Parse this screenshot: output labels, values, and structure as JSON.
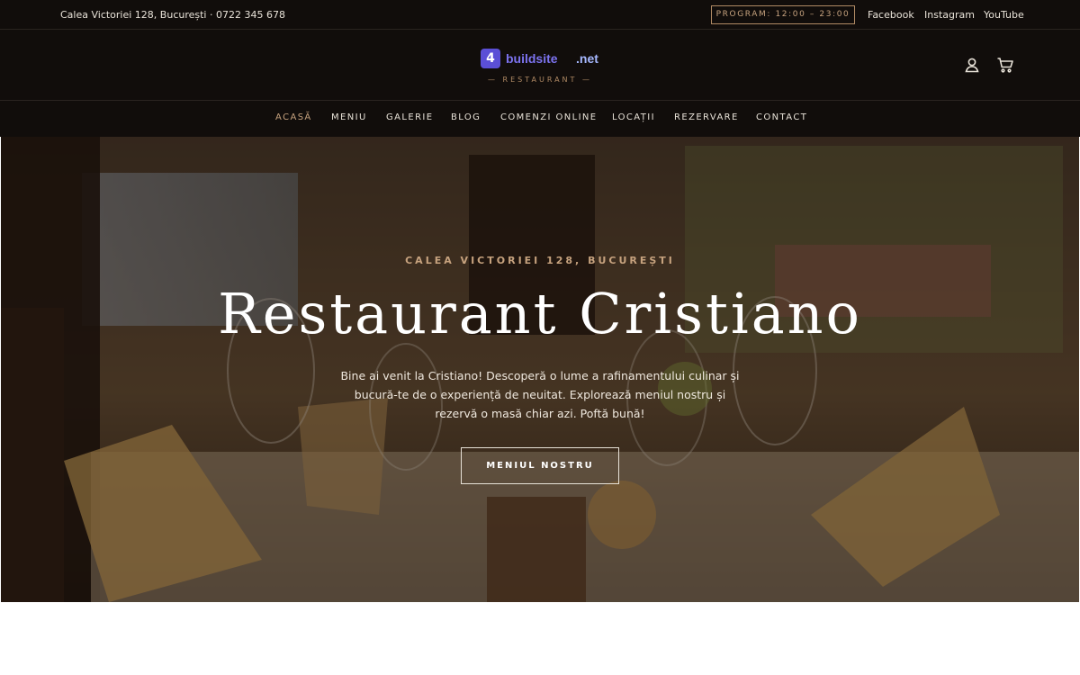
{
  "topbar": {
    "address_phone": "Calea Victoriei 128, București · 0722 345 678",
    "hours": "PROGRAM: 12:00 – 23:00",
    "social": [
      "Facebook",
      "Instagram",
      "YouTube"
    ]
  },
  "header": {
    "logo": {
      "badge": "4",
      "name": "buildsite",
      "tld": ".net",
      "tagline": "— RESTAURANT —"
    },
    "icons": [
      "user-icon",
      "cart-icon"
    ]
  },
  "nav": {
    "items": [
      "ACASĂ",
      "MENIU",
      "GALERIE",
      "BLOG",
      "COMENZI ONLINE",
      "LOCAȚII",
      "REZERVARE",
      "CONTACT"
    ],
    "active": "ACASĂ"
  },
  "hero": {
    "eyebrow": "CALEA VICTORIEI 128, BUCUREȘTI",
    "title": "Restaurant Cristiano",
    "lead": "Bine ai venit la Cristiano! Descoperă o lume a rafinamentului culinar și bucură-te de o experiență de neuitat. Explorează meniul nostru și rezervă o masă chiar azi. Poftă bună!",
    "cta": "MENIUL NOSTRU"
  },
  "colors": {
    "dark_bg": "#110d0b",
    "accent_gold": "#c6a27e",
    "logo_purple": "#5b4fd6"
  }
}
